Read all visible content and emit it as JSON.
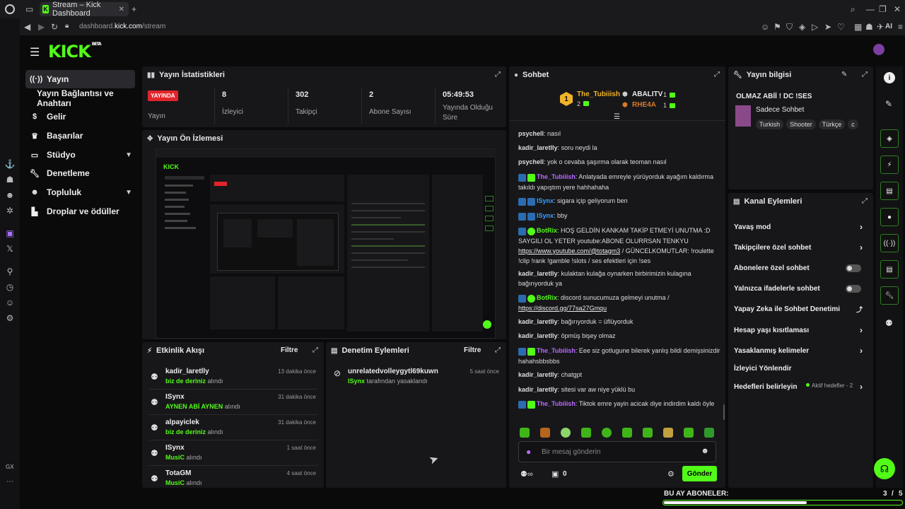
{
  "browser": {
    "tab_title": "Stream – Kick Dashboard",
    "url_prefix": "dashboard.",
    "url_domain": "kick.com",
    "url_path": "/stream",
    "ai_label": "AI",
    "gx_label": "GX"
  },
  "brand": {
    "logo": "KICK",
    "beta": "BETA"
  },
  "sidebar": {
    "items": [
      {
        "label": "Yayın",
        "icon": "broadcast-icon"
      },
      {
        "label": "Yayın Bağlantısı ve Anahtarı"
      },
      {
        "label": "Gelir",
        "icon": "money-icon"
      },
      {
        "label": "Başarılar",
        "icon": "trophy-icon"
      },
      {
        "label": "Stüdyo",
        "icon": "studio-icon"
      },
      {
        "label": "Denetleme",
        "icon": "wrench-icon"
      },
      {
        "label": "Topluluk",
        "icon": "community-icon"
      },
      {
        "label": "Droplar ve ödüller",
        "icon": "drops-icon"
      }
    ]
  },
  "stats": {
    "title": "Yayın İstatistikleri",
    "live_badge": "YAYINDA",
    "items": [
      {
        "value": "",
        "label": "Yayın"
      },
      {
        "value": "8",
        "label": "İzleyici"
      },
      {
        "value": "302",
        "label": "Takipçi"
      },
      {
        "value": "2",
        "label": "Abone Sayısı"
      },
      {
        "value": "05:49:53",
        "label": "Yayında Olduğu Süre"
      }
    ]
  },
  "preview": {
    "title": "Yayın Ön İzlemesi"
  },
  "activity": {
    "title": "Etkinlik Akışı",
    "filter": "Filtre",
    "items": [
      {
        "user": "kadir_laretlly",
        "item": "biz de deriniz",
        "suffix": "alındı",
        "time": "13 dakika önce"
      },
      {
        "user": "ISynx",
        "item": "AYNEN ABİ AYNEN",
        "suffix": "alındı",
        "time": "31 dakika önce"
      },
      {
        "user": "alpayiclek",
        "item": "biz de deriniz",
        "suffix": "alındı",
        "time": "31 dakika önce"
      },
      {
        "user": "ISynx",
        "item": "MusiC",
        "suffix": "alındı",
        "time": "1 saat önce"
      },
      {
        "user": "TotaGM",
        "item": "MusiC",
        "suffix": "alındı",
        "time": "4 saat önce"
      }
    ]
  },
  "moderation": {
    "title": "Denetim Eylemleri",
    "filter": "Filtre",
    "items": [
      {
        "user": "unrelatedvolleygytl69kuwn",
        "by": "ISynx",
        "action": "tarafından yasaklandı",
        "time": "5 saat önce"
      }
    ]
  },
  "chat": {
    "title": "Sohbet",
    "leaders": {
      "first": {
        "name": "The_Tubiiish",
        "count": "2",
        "rank": "1"
      },
      "second": {
        "name": "ABALITV",
        "count": "1"
      },
      "third": {
        "name": "RHE4A",
        "count": "1"
      }
    },
    "messages": [
      {
        "user": "psychell",
        "text": "nasıl",
        "color": "#e8e8e8"
      },
      {
        "user": "kadir_laretlly",
        "text": "soru neydi la",
        "color": "#e8e8e8"
      },
      {
        "user": "psychell",
        "text": "yok o cevaba şaşırma olarak teoman nasıl",
        "color": "#e8e8e8"
      },
      {
        "user": "The_Tubiiish",
        "text": "Anlatyada emreyle yürüyorduk ayağım kaldırma takıldı yapıştım yere hahhahaha",
        "color": "#b86bff"
      },
      {
        "user": "ISynx",
        "text": "sigara içip geliyorum ben",
        "color": "#3aa0ff"
      },
      {
        "user": "ISynx",
        "text": "bby",
        "color": "#3aa0ff"
      },
      {
        "user": "BotRix",
        "text": "HOŞ GELDİN KANKAM TAKİP ETMEYİ UNUTMA :D SAYGILI OL YETER youtube:ABONE OLURRSAN TENKYU",
        "link": "https://www.youtube.com/@totagm3",
        "text2": " / GÜNCELKOMUTLAR: !roulette !clip !rank !gamble !slots / ses efektleri için !ses",
        "color": "#53fc18"
      },
      {
        "user": "kadir_laretlly",
        "text": "kulaktan kulağa oynarken birbirimizin kulagına bağırıyorduk ya",
        "color": "#e8e8e8"
      },
      {
        "user": "BotRix",
        "text": "discord sunucumuza gelmeyi unutma /",
        "link": "https://discord.gg/77sa27Gmqu",
        "color": "#53fc18"
      },
      {
        "user": "kadir_laretlly",
        "text": "bağırıyorduk = üflüyorduk",
        "color": "#e8e8e8"
      },
      {
        "user": "kadir_laretlly",
        "text": "öpmüş bişey olmaz",
        "color": "#e8e8e8"
      },
      {
        "user": "The_Tubiiish",
        "text": "Eee siz gotlugune bilerek yanlış bildi demişsinizdir hahahsbbsbbs",
        "color": "#b86bff"
      },
      {
        "user": "kadir_laretlly",
        "text": "chatgpt",
        "color": "#e8e8e8"
      },
      {
        "user": "kadir_laretlly",
        "text": "sitesi var aw niye yüklü bu",
        "color": "#e8e8e8"
      },
      {
        "user": "The_Tubiiish",
        "text": "Tiktok emre yayin acicak diye indirdim kaldı öyle",
        "color": "#b86bff"
      }
    ],
    "input_placeholder": "Bir mesaj gönderin",
    "viewer_count": "0",
    "send_label": "Gönder"
  },
  "stream_info": {
    "title": "Yayın bilgisi",
    "stream_title": "OLMAZ ABİİ ! DC !SES",
    "category": "Sadece Sohbet",
    "tags": [
      "Turkish",
      "Shooter",
      "Türkçe",
      "c"
    ]
  },
  "channel_actions": {
    "title": "Kanal Eylemleri",
    "items": [
      {
        "label": "Yavaş mod",
        "type": "arrow"
      },
      {
        "label": "Takipçilere özel sohbet",
        "type": "arrow"
      },
      {
        "label": "Abonelere özel sohbet",
        "type": "toggle"
      },
      {
        "label": "Yalnızca ifadelerle sohbet",
        "type": "toggle"
      },
      {
        "label": "Yapay Zeka ile Sohbet Denetimi",
        "type": "external"
      },
      {
        "label": "Hesap yaşı kısıtlaması",
        "type": "arrow"
      },
      {
        "label": "Yasaklanmış kelimeler",
        "type": "arrow"
      },
      {
        "label": "İzleyici Yönlendir",
        "type": "none"
      },
      {
        "label": "Hedefleri belirleyin",
        "type": "arrow",
        "note": "Aktif hedefler - 2"
      }
    ]
  },
  "goal": {
    "label": "BU AY ABONELER:",
    "current": "3",
    "separator": "/",
    "target": "5",
    "progress": 0.6
  },
  "colors": {
    "accent": "#53fc18",
    "live": "#e3242b"
  }
}
